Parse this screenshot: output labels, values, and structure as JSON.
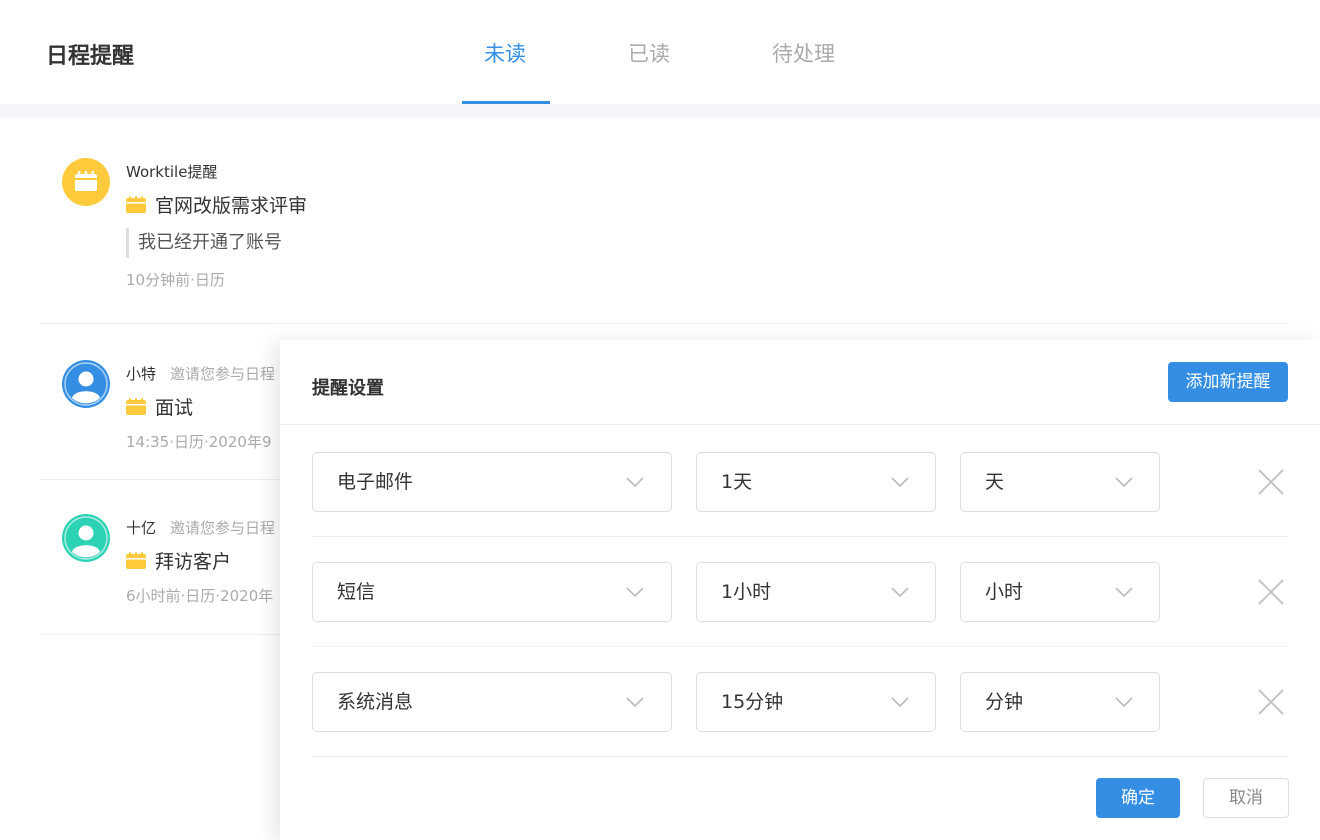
{
  "header": {
    "title": "日程提醒",
    "tabs": [
      {
        "label": "未读",
        "active": true
      },
      {
        "label": "已读",
        "active": false
      },
      {
        "label": "待处理",
        "active": false
      }
    ]
  },
  "colors": {
    "accent": "#348fe4",
    "muted": "#aaaaaa",
    "calendar_yellow": "#ffcb3d",
    "avatar_blue": "#348fe4",
    "avatar_teal": "#2cd2b4"
  },
  "notifications": [
    {
      "sender": "Worktile提醒",
      "invite_text": "",
      "title": "官网改版需求评审",
      "quote": "我已经开通了账号",
      "meta": "10分钟前·日历",
      "avatar_icon": "calendar-icon"
    },
    {
      "sender": "小特",
      "invite_text": "邀请您参与日程",
      "title": "面试",
      "quote": "",
      "meta": "14:35·日历·2020年9",
      "avatar_icon": "user-icon"
    },
    {
      "sender": "十亿",
      "invite_text": "邀请您参与日程",
      "title": "拜访客户",
      "quote": "",
      "meta": "6小时前·日历·2020年",
      "avatar_icon": "user-icon"
    }
  ],
  "panel": {
    "title": "提醒设置",
    "add_button": "添加新提醒",
    "rows": [
      {
        "method": "电子邮件",
        "amount": "1天",
        "unit": "天"
      },
      {
        "method": "短信",
        "amount": "1小时",
        "unit": "小时"
      },
      {
        "method": "系统消息",
        "amount": "15分钟",
        "unit": "分钟"
      }
    ],
    "confirm_button": "确定",
    "cancel_button": "取消"
  }
}
